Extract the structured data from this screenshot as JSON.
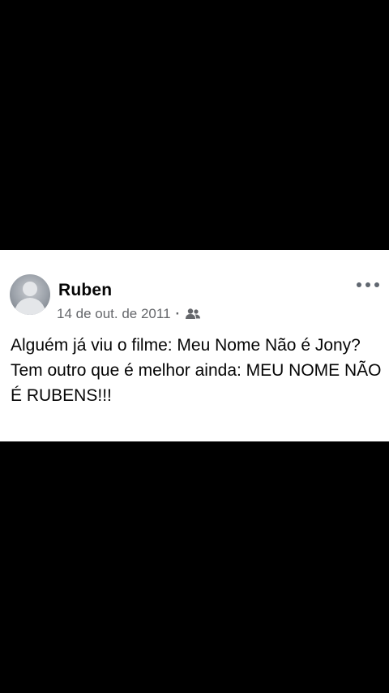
{
  "post": {
    "author": "Ruben",
    "date": "14 de out. de 2011",
    "separator": "·",
    "audience_icon": "friends-icon",
    "more_icon": "more-options-icon",
    "text": "Alguém já viu o filme: Meu Nome Não é Jony?\nTem outro que é melhor ainda: MEU NOME NÃO É RUBENS!!!"
  },
  "colors": {
    "background": "#000000",
    "card": "#ffffff",
    "text_primary": "#050505",
    "text_secondary": "#65676b"
  }
}
